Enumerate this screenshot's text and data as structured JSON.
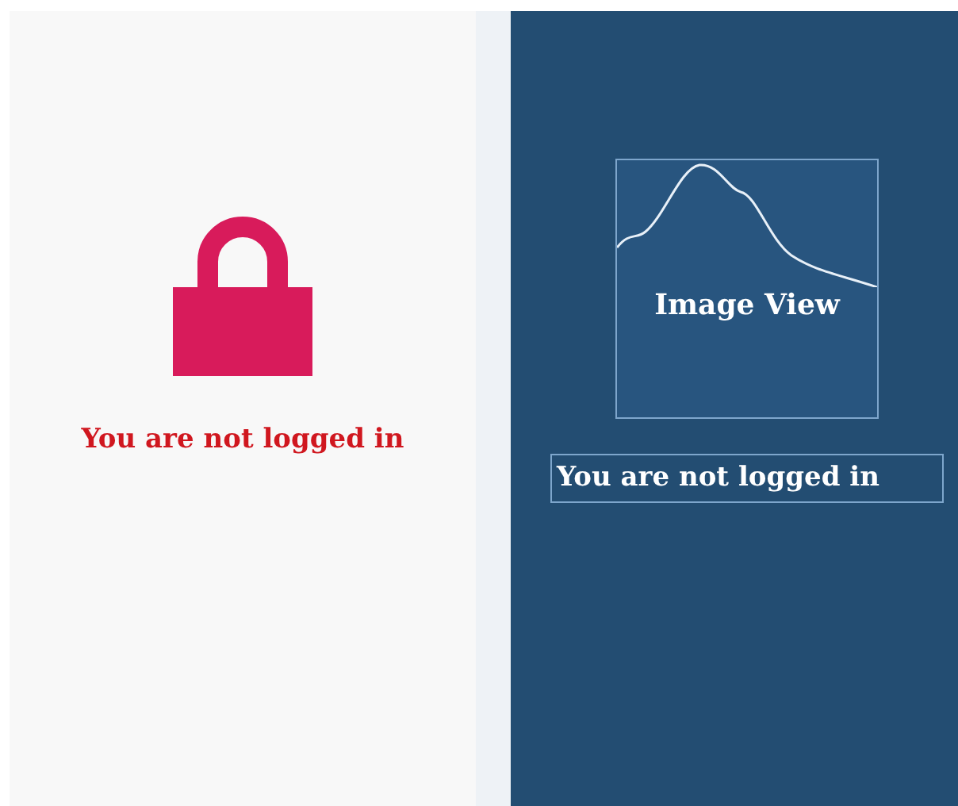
{
  "left_panel": {
    "message": "You are not logged in"
  },
  "right_panel": {
    "image_view": {
      "label": "Image View"
    },
    "message_field": {
      "value": "You are not logged in"
    }
  }
}
